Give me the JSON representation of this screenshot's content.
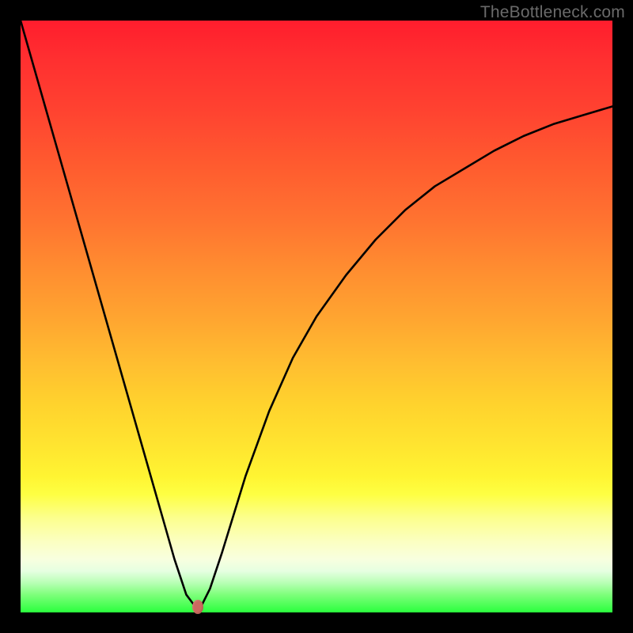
{
  "watermark": "TheBottleneck.com",
  "chart_data": {
    "type": "line",
    "title": "",
    "xlabel": "",
    "ylabel": "",
    "xlim": [
      0,
      100
    ],
    "ylim": [
      0,
      100
    ],
    "grid": false,
    "series": [
      {
        "name": "curve",
        "x": [
          0,
          4,
          8,
          12,
          16,
          20,
          24,
          26,
          28,
          29.5,
          30.5,
          32,
          34,
          38,
          42,
          46,
          50,
          55,
          60,
          65,
          70,
          75,
          80,
          85,
          90,
          95,
          100
        ],
        "y": [
          100,
          86,
          72,
          58,
          44,
          30,
          16,
          9,
          3,
          1,
          1,
          4,
          10,
          23,
          34,
          43,
          50,
          57,
          63,
          68,
          72,
          75,
          78,
          80.5,
          82.5,
          84,
          85.5
        ]
      }
    ],
    "marker": {
      "x": 30,
      "y": 1
    }
  },
  "colors": {
    "curve": "#000000",
    "marker": "#cc6a5f",
    "background_top": "#ff1d2d",
    "background_bottom": "#2aff3d",
    "frame": "#000000"
  }
}
